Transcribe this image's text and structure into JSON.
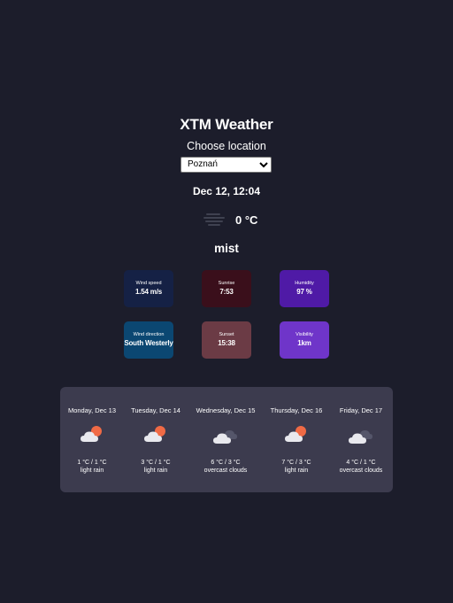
{
  "app": {
    "title": "XTM Weather"
  },
  "location": {
    "label": "Choose location",
    "selected": "Poznań"
  },
  "current": {
    "date": "Dec 12, 12:04",
    "temperature": "0 °C",
    "icon": "mist-icon",
    "description": "mist"
  },
  "details": [
    {
      "label": "Wind speed",
      "value": "1.54 m/s",
      "color": "#152145"
    },
    {
      "label": "Sunrise",
      "value": "7:53",
      "color": "#3a0f1b"
    },
    {
      "label": "Humidity",
      "value": "97 %",
      "color": "#4f1aa6"
    },
    {
      "label": "Wind direction",
      "value": "South Westerly",
      "color": "#0b4772"
    },
    {
      "label": "Sunset",
      "value": "15:38",
      "color": "#6b3b45"
    },
    {
      "label": "Visibility",
      "value": "1km",
      "color": "#6f35c9"
    }
  ],
  "forecast": [
    {
      "date": "Monday, Dec 13",
      "temp": "1 °C / 1 °C",
      "desc": "light rain",
      "icon": "cloud-sun-icon"
    },
    {
      "date": "Tuesday, Dec 14",
      "temp": "3 °C / 1 °C",
      "desc": "light rain",
      "icon": "cloud-sun-icon"
    },
    {
      "date": "Wednesday, Dec 15",
      "temp": "6 °C / 3 °C",
      "desc": "overcast clouds",
      "icon": "overcast-clouds-icon"
    },
    {
      "date": "Thursday, Dec 16",
      "temp": "7 °C / 3 °C",
      "desc": "light rain",
      "icon": "cloud-sun-icon"
    },
    {
      "date": "Friday, Dec 17",
      "temp": "4 °C / 1 °C",
      "desc": "overcast clouds",
      "icon": "overcast-clouds-icon"
    }
  ]
}
